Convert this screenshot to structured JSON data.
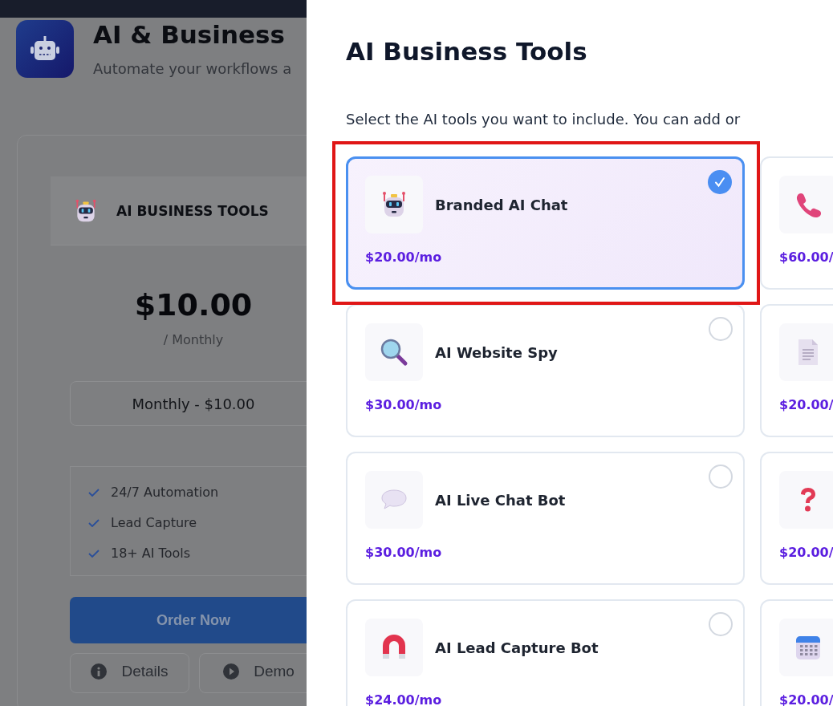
{
  "page": {
    "title": "AI & Business",
    "subtitle": "Automate your workflows a",
    "plan_card": {
      "tab": "AI BUSINESS TOOLS",
      "price": "$10.00",
      "period": "/ Monthly",
      "billing_select": "Monthly - $10.00",
      "features": [
        "24/7 Automation",
        "Lead Capture",
        "18+ AI Tools"
      ],
      "order_button": "Order Now",
      "buttons": [
        "Details",
        "Demo"
      ]
    }
  },
  "drawer": {
    "title": "AI Business Tools",
    "subtitle": "Select the AI tools you want to include. You can add or",
    "tools": [
      {
        "name": "Branded AI Chat",
        "price": "$20.00/mo",
        "selected": true,
        "highlighted": true
      },
      {
        "price": "$60.00/"
      },
      {
        "name": "AI Website Spy",
        "price": "$30.00/mo",
        "selected": false,
        "highlighted": false
      },
      {
        "price": "$20.00/"
      },
      {
        "name": "AI Live Chat Bot",
        "price": "$30.00/mo",
        "selected": false,
        "highlighted": false
      },
      {
        "price": "$20.00/"
      },
      {
        "name": "AI Lead Capture Bot",
        "price": "$24.00/mo",
        "selected": false,
        "highlighted": false
      },
      {
        "price": "$20.00/"
      }
    ]
  }
}
